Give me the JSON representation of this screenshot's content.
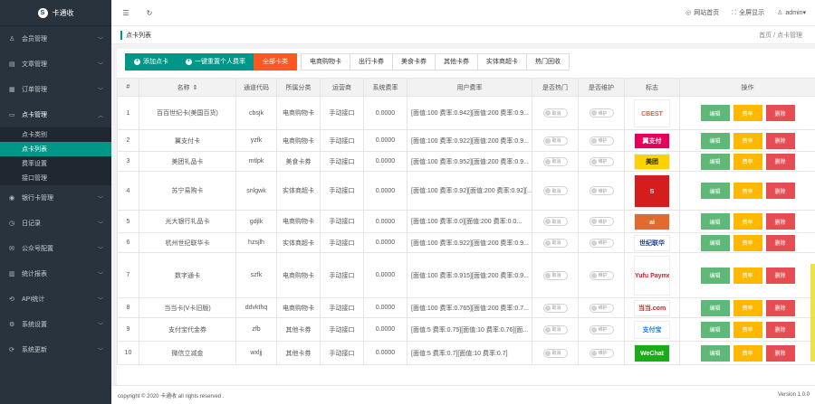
{
  "app": {
    "name": "卡通收"
  },
  "colors": {
    "sidebar": "#28333e",
    "accent": "#009688",
    "danger": "#ff5722",
    "edit": "#5fb878",
    "rate": "#ffb800",
    "delete": "#e64d53"
  },
  "sidebar": {
    "items": [
      {
        "label": "会员管理",
        "icon": "user-icon"
      },
      {
        "label": "文章管理",
        "icon": "document-icon"
      },
      {
        "label": "订单管理",
        "icon": "order-icon"
      },
      {
        "label": "点卡管理",
        "icon": "card-icon",
        "open": true,
        "children": [
          {
            "label": "点卡类别",
            "active": false
          },
          {
            "label": "点卡列表",
            "active": true
          },
          {
            "label": "费率设置",
            "active": false
          },
          {
            "label": "接口管理",
            "active": false
          }
        ]
      },
      {
        "label": "银行卡管理",
        "icon": "bank-icon"
      },
      {
        "label": "日记录",
        "icon": "log-icon"
      },
      {
        "label": "公众号配置",
        "icon": "wechat-icon"
      },
      {
        "label": "统计报表",
        "icon": "report-icon"
      },
      {
        "label": "API统计",
        "icon": "api-icon"
      },
      {
        "label": "系统设置",
        "icon": "settings-icon"
      },
      {
        "label": "系统更新",
        "icon": "update-icon"
      }
    ]
  },
  "topbar": {
    "site_home": "网站首页",
    "fullscreen": "全屏显示",
    "user": "admin"
  },
  "titlebar": {
    "title": "点卡列表",
    "crumbs": "首页 / 点卡管理"
  },
  "toolbar": {
    "add": "添加点卡",
    "batch": "一键重置个人费率",
    "all_cards": "全部卡类",
    "tabs": [
      "电商购物卡",
      "出行卡券",
      "美食卡券",
      "其他卡券",
      "实体商超卡",
      "热门回收"
    ]
  },
  "table": {
    "headers": [
      "#",
      "名称",
      "通道代码",
      "所属分类",
      "运营商",
      "系统费率",
      "用户费率",
      "是否热门",
      "是否维护",
      "标志",
      "操作"
    ],
    "sort_icon": "⇕",
    "switch_labels": {
      "hot": "取消",
      "maint": "维护"
    },
    "actions": {
      "edit": "编辑",
      "rate": "费率",
      "delete": "删除"
    },
    "rows": [
      {
        "no": "1",
        "name": "百百世纪卡(美国百货)",
        "code": "cbsjk",
        "category": "电商购物卡",
        "operator": "手动接口",
        "sys_rate": "0.0000",
        "user_rate": "[面值:100 费率:0.942][面值:200 费率:0.9...",
        "logo": "CBEST",
        "logo_color": "#e85a24",
        "logo_bg": "#fff"
      },
      {
        "no": "2",
        "name": "翼支付卡",
        "code": "yzfk",
        "category": "电商购物卡",
        "operator": "手动接口",
        "sys_rate": "0.0000",
        "user_rate": "[面值:100 费率:0.922][面值:200 费率:0.9...",
        "logo": "翼支付",
        "logo_color": "#fff",
        "logo_bg": "#e6005c"
      },
      {
        "no": "3",
        "name": "美团礼品卡",
        "code": "mtlpk",
        "category": "美食卡券",
        "operator": "手动接口",
        "sys_rate": "0.0000",
        "user_rate": "[面值:100 费率:0.952][面值:200 费率:0.9...",
        "logo": "美团",
        "logo_color": "#222",
        "logo_bg": "#ffd100"
      },
      {
        "no": "4",
        "name": "苏宁易购卡",
        "code": "snlgwk",
        "category": "实体商超卡",
        "operator": "手动接口",
        "sys_rate": "0.0000",
        "user_rate": "[面值:100 费率:0.92][面值:200 费率:0.92][...",
        "logo": "S",
        "logo_color": "#fff",
        "logo_bg": "#d61d1d"
      },
      {
        "no": "5",
        "name": "光大银行礼品卡",
        "code": "gdjlk",
        "category": "电商购物卡",
        "operator": "手动接口",
        "sys_rate": "0.0000",
        "user_rate": "[面值:100 费率:0.0][面值:200 费率:0.0...",
        "logo": "ai",
        "logo_color": "#fff",
        "logo_bg": "#e26a2c"
      },
      {
        "no": "6",
        "name": "杭州世纪联华卡",
        "code": "hzsjlh",
        "category": "实体商超卡",
        "operator": "手动接口",
        "sys_rate": "0.0000",
        "user_rate": "[面值:100 费率:0.922][面值:200 费率:0.9...",
        "logo": "世纪联华",
        "logo_color": "#1a3f8f",
        "logo_bg": "#fff"
      },
      {
        "no": "7",
        "name": "数字通卡",
        "code": "szfk",
        "category": "电商购物卡",
        "operator": "手动接口",
        "sys_rate": "0.0000",
        "user_rate": "[面值:100 费率:0.915][面值:200 费率:0.9...",
        "logo": "Yufu Payment",
        "logo_color": "#d01f28",
        "logo_bg": "#fff"
      },
      {
        "no": "8",
        "name": "当当卡(V卡旧版)",
        "code": "ddvkthq",
        "category": "电商购物卡",
        "operator": "手动接口",
        "sys_rate": "0.0000",
        "user_rate": "[面值:100 费率:0.765][面值:200 费率:0.7...",
        "logo": "当当.com",
        "logo_color": "#e6172a",
        "logo_bg": "#fff"
      },
      {
        "no": "9",
        "name": "支付宝代金券",
        "code": "zfb",
        "category": "其他卡券",
        "operator": "手动接口",
        "sys_rate": "0.0000",
        "user_rate": "[面值:5 费率:0.75][面值:10 费率:0.76][面...",
        "logo": "支付宝",
        "logo_color": "#1677ff",
        "logo_bg": "#fff"
      },
      {
        "no": "10",
        "name": "微信立减金",
        "code": "wxljj",
        "category": "其他卡券",
        "operator": "手动接口",
        "sys_rate": "0.0000",
        "user_rate": "[面值:5 费率:0.7][面值:10 费率:0.7]",
        "logo": "WeChat",
        "logo_color": "#fff",
        "logo_bg": "#1aad19"
      }
    ]
  },
  "footer": {
    "copyright": "copyright © 2020 卡通收 all rights reserved .",
    "version": "Version 1.0.0"
  }
}
